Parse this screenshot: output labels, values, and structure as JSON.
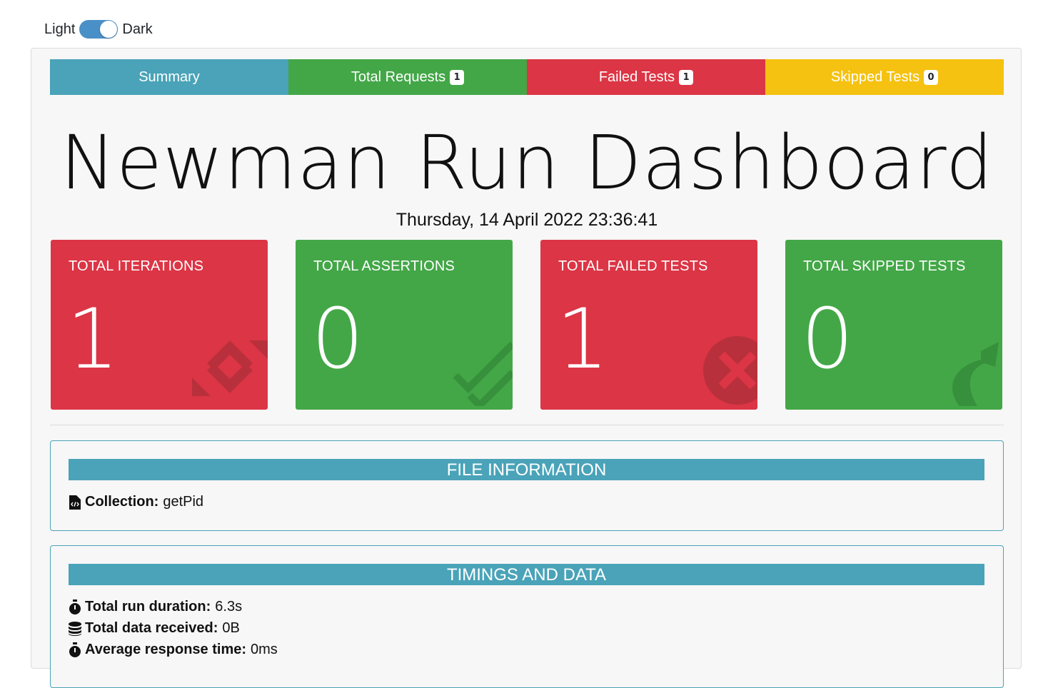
{
  "theme_toggle": {
    "light_label": "Light",
    "dark_label": "Dark",
    "state": "dark"
  },
  "tabs": [
    {
      "label": "Summary",
      "badge": ""
    },
    {
      "label": "Total Requests",
      "badge": "1"
    },
    {
      "label": "Failed Tests",
      "badge": "1"
    },
    {
      "label": "Skipped Tests",
      "badge": "0"
    }
  ],
  "dashboard": {
    "title": "Newman Run Dashboard",
    "date": "Thursday, 14 April 2022 23:36:41"
  },
  "cards": [
    {
      "title": "TOTAL ITERATIONS",
      "value": "1",
      "icon": "sync-icon",
      "color": "#dc3545"
    },
    {
      "title": "TOTAL ASSERTIONS",
      "value": "0",
      "icon": "check-double-icon",
      "color": "#43a747"
    },
    {
      "title": "TOTAL FAILED TESTS",
      "value": "1",
      "icon": "times-circle-icon",
      "color": "#dc3545"
    },
    {
      "title": "TOTAL SKIPPED TESTS",
      "value": "0",
      "icon": "share-arrow-icon",
      "color": "#43a747"
    }
  ],
  "file_info": {
    "header": "FILE INFORMATION",
    "collection_label": "Collection:",
    "collection_value": "getPid"
  },
  "timings": {
    "header": "TIMINGS AND DATA",
    "rows": [
      {
        "label": "Total run duration:",
        "value": "6.3s",
        "icon": "stopwatch-icon"
      },
      {
        "label": "Total data received:",
        "value": "0B",
        "icon": "database-icon"
      },
      {
        "label": "Average response time:",
        "value": "0ms",
        "icon": "stopwatch-icon"
      }
    ]
  },
  "colors": {
    "summary": "#4aa3b8",
    "success": "#43a747",
    "danger": "#dc3545",
    "warning": "#f5c211"
  }
}
